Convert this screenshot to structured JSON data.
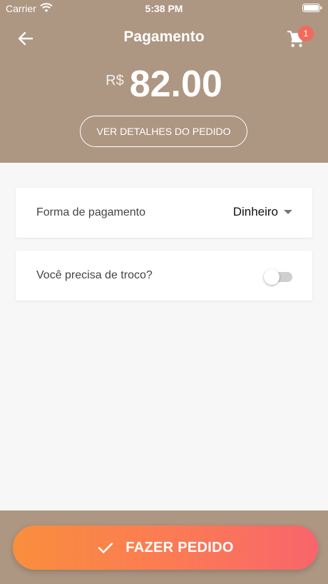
{
  "status_bar": {
    "carrier": "Carrier",
    "time": "5:38 PM"
  },
  "header": {
    "title": "Pagamento",
    "cart_badge": "1",
    "currency": "R$",
    "amount": "82.00",
    "details_button_label": "VER DETALHES DO PEDIDO"
  },
  "payment": {
    "method_label": "Forma de pagamento",
    "method_value": "Dinheiro",
    "change_label": "Você precisa de troco?",
    "change_toggle_on": false
  },
  "footer": {
    "place_order_label": "FAZER PEDIDO"
  },
  "colors": {
    "header_bg": "#ad9682",
    "badge": "#f26a5b",
    "button_gradient_start": "#fa8e3d",
    "button_gradient_end": "#f8656c",
    "page_bg": "#f7f7f7"
  },
  "icons": [
    "wifi-icon",
    "battery-icon",
    "back-arrow-icon",
    "cart-icon",
    "chevron-down-icon",
    "check-icon"
  ]
}
